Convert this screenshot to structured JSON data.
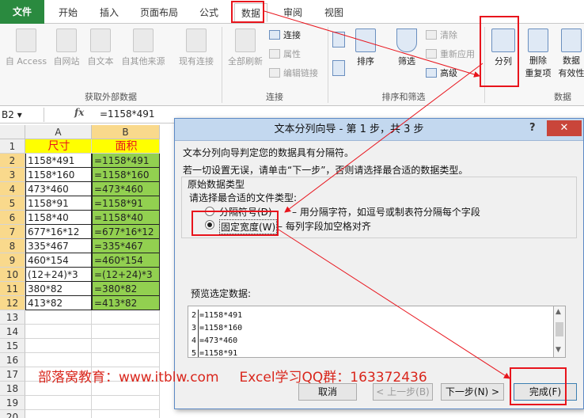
{
  "tabs": [
    {
      "label": "文件"
    },
    {
      "label": "开始"
    },
    {
      "label": "插入"
    },
    {
      "label": "页面布局"
    },
    {
      "label": "公式"
    },
    {
      "label": "数据"
    },
    {
      "label": "审阅"
    },
    {
      "label": "视图"
    }
  ],
  "ribbon": {
    "external": {
      "items": [
        "自 Access",
        "自网站",
        "自文本",
        "自其他来源",
        "现有连接"
      ],
      "label": "获取外部数据"
    },
    "connections": {
      "refresh": "全部刷新",
      "items": [
        "连接",
        "属性",
        "编辑链接"
      ],
      "label": "连接"
    },
    "sort_filter": {
      "sort": "排序",
      "filter": "筛选",
      "items": [
        "清除",
        "重新应用",
        "高级"
      ],
      "label": "排序和筛选"
    },
    "tools": {
      "split": "分列",
      "dedupe_1": "删除",
      "dedupe_2": "重复项",
      "validation_1": "数据",
      "validation_2": "有效性",
      "label": "数据"
    }
  },
  "formula_bar": {
    "name_box": "B2",
    "fx": "fx",
    "formula": "=1158*491"
  },
  "sheet": {
    "columns": [
      "A",
      "B"
    ],
    "header_row": [
      "尺寸",
      "面积"
    ],
    "rows": [
      [
        "1158*491",
        "=1158*491"
      ],
      [
        "1158*160",
        "=1158*160"
      ],
      [
        "473*460",
        "=473*460"
      ],
      [
        "1158*91",
        "=1158*91"
      ],
      [
        "1158*40",
        "=1158*40"
      ],
      [
        "677*16*12",
        "=677*16*12"
      ],
      [
        "335*467",
        "=335*467"
      ],
      [
        "460*154",
        "=460*154"
      ],
      [
        "(12+24)*3",
        "=(12+24)*3"
      ],
      [
        "380*82",
        "=380*82"
      ],
      [
        "413*82",
        "=413*82"
      ]
    ],
    "row_numbers": [
      "1",
      "2",
      "3",
      "4",
      "5",
      "6",
      "7",
      "8",
      "9",
      "10",
      "11",
      "12",
      "13",
      "14",
      "15",
      "16",
      "17",
      "18",
      "19",
      "20"
    ]
  },
  "dialog": {
    "title": "文本分列向导 - 第 1 步，共 3 步",
    "help": "?",
    "close": "✕",
    "line1": "文本分列向导判定您的数据具有分隔符。",
    "line2": "若一切设置无误，请单击“下一步”，否则请选择最合适的数据类型。",
    "group_title": "原始数据类型",
    "group_prompt": "请选择最合适的文件类型:",
    "option_delimited": "分隔符号(D)",
    "option_delimited_desc": "– 用分隔字符，如逗号或制表符分隔每个字段",
    "option_fixed": "固定宽度(W)",
    "option_fixed_desc": "– 每列字段加空格对齐",
    "preview_label": "预览选定数据:",
    "preview_rows": [
      {
        "num": "2",
        "text": "=1158*491"
      },
      {
        "num": "3",
        "text": "=1158*160"
      },
      {
        "num": "4",
        "text": "=473*460"
      },
      {
        "num": "5",
        "text": "=1158*91"
      }
    ],
    "buttons": {
      "cancel": "取消",
      "back": "< 上一步(B)",
      "next": "下一步(N) >",
      "finish": "完成(F)"
    }
  },
  "watermark": {
    "site": "部落窝教育：www.itblw.com",
    "qq": "Excel学习QQ群：163372436"
  },
  "colors": {
    "file_tab": "#2a8a3f",
    "header_fill": "#ffff00",
    "header_text": "#e8141c",
    "formula_fill": "#92d050",
    "annotation": "#e8141c"
  }
}
